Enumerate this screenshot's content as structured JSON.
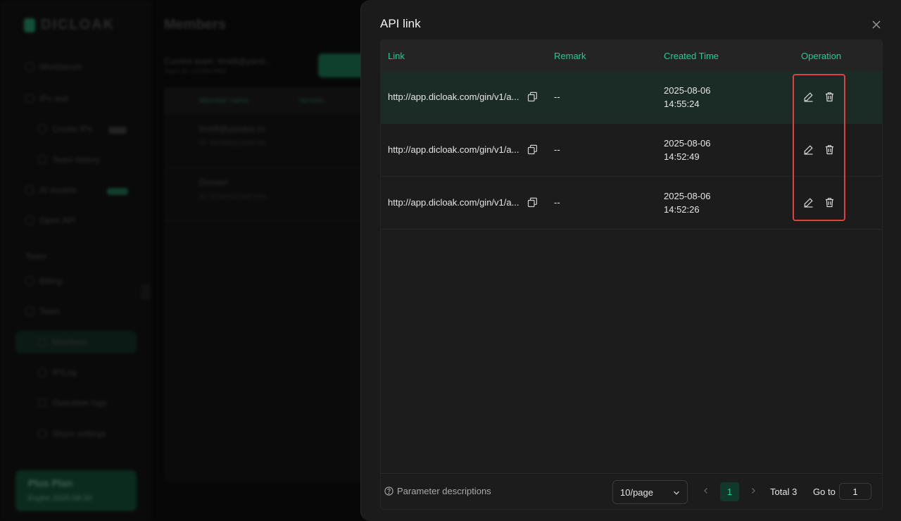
{
  "background": {
    "logo_text": "DICLOAK",
    "page_title": "Members",
    "team_label": "Current team: limit9@yand...",
    "team_sub": "Team ID: 1234567890",
    "nav_items": [
      "Workbench",
      "IPs and",
      "Create IPs",
      "Team history",
      "AI models",
      "Open API",
      "Team",
      "Billing",
      "Team",
      "Members",
      "IP/Log",
      "Operation logs",
      "Share settings"
    ],
    "table_headers": [
      "Member name",
      "Version"
    ],
    "rows": [
      {
        "name": "limit9@yandex.ru",
        "sub": "ID: 4567890123456789"
      },
      {
        "name": "Dossier",
        "sub": "ID: 9876543210987654"
      }
    ],
    "plan_title": "Plus Plan",
    "plan_sub": "Expire 2025-08-30"
  },
  "drawer": {
    "title": "API link",
    "columns": {
      "link": "Link",
      "remark": "Remark",
      "created_time": "Created Time",
      "operation": "Operation"
    },
    "rows": [
      {
        "link": "http://app.dicloak.com/gin/v1/a...",
        "remark": "--",
        "date": "2025-08-06",
        "time": "14:55:24"
      },
      {
        "link": "http://app.dicloak.com/gin/v1/a...",
        "remark": "--",
        "date": "2025-08-06",
        "time": "14:52:49"
      },
      {
        "link": "http://app.dicloak.com/gin/v1/a...",
        "remark": "--",
        "date": "2025-08-06",
        "time": "14:52:26"
      }
    ],
    "footer": {
      "param_desc": "Parameter descriptions",
      "page_size": "10/page",
      "current_page": "1",
      "total": "Total 3",
      "goto_label": "Go to",
      "goto_value": "1"
    }
  },
  "icons": {
    "close": "close-icon",
    "copy": "copy-icon",
    "edit": "edit-icon",
    "delete": "trash-icon",
    "help": "question-circle-icon",
    "chevron_down": "chevron-down-icon",
    "prev": "chevron-left-icon",
    "next": "chevron-right-icon"
  },
  "colors": {
    "accent": "#1ecf91",
    "highlight_border": "#e0413e",
    "drawer_bg": "#1b1b1b",
    "header_bg": "#242424",
    "active_row_bg": "#1a2c25"
  }
}
